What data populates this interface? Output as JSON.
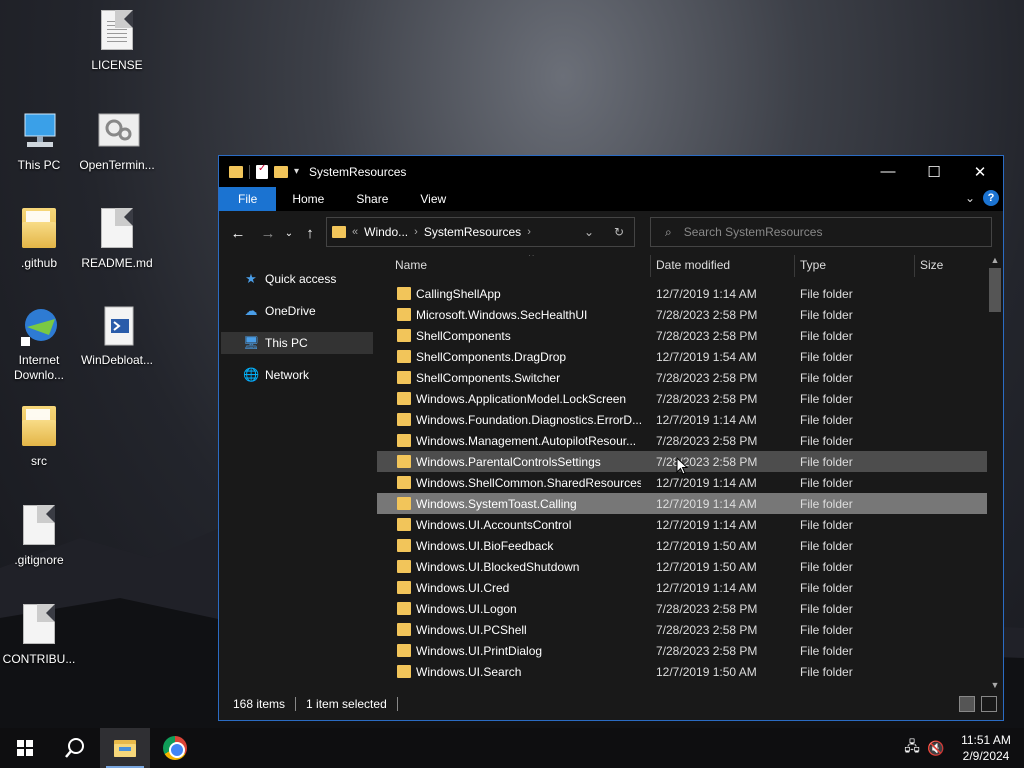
{
  "desktop": {
    "icons": [
      {
        "label": "LICENSE",
        "type": "document"
      },
      {
        "label": "This PC",
        "type": "computer"
      },
      {
        "label": "OpenTermin...",
        "type": "settings"
      },
      {
        "label": ".github",
        "type": "folder"
      },
      {
        "label": "README.md",
        "type": "document"
      },
      {
        "label": "Internet Downlo...",
        "type": "app"
      },
      {
        "label": "WinDebloat...",
        "type": "script"
      },
      {
        "label": "src",
        "type": "folder"
      },
      {
        "label": ".gitignore",
        "type": "document"
      },
      {
        "label": "CONTRIBU...",
        "type": "document"
      }
    ]
  },
  "explorer": {
    "title": "SystemResources",
    "window_buttons": {
      "minimize": "—",
      "maximize": "☐",
      "close": "✕"
    },
    "ribbon_tabs": [
      "File",
      "Home",
      "Share",
      "View"
    ],
    "help_label": "?",
    "nav_icons": {
      "back": "←",
      "forward": "→",
      "recent": "⌄",
      "up": "↑"
    },
    "address": {
      "overflow": "«",
      "segments": [
        "Windo...",
        "SystemResources"
      ],
      "separator": "›",
      "refresh_icon": "↻",
      "dropdown_icon": "⌄"
    },
    "search": {
      "placeholder": "Search SystemResources",
      "icon": "⌕"
    },
    "nav_pane": [
      {
        "label": "Quick access",
        "icon": "star-icon",
        "glyph": "★"
      },
      {
        "label": "OneDrive",
        "icon": "cloud-icon",
        "glyph": "☁"
      },
      {
        "label": "This PC",
        "icon": "computer-icon",
        "glyph": "🖥",
        "selected": true
      },
      {
        "label": "Network",
        "icon": "network-icon",
        "glyph": "🌐"
      }
    ],
    "columns": [
      "Name",
      "Date modified",
      "Type",
      "Size"
    ],
    "files": [
      {
        "name": "CallingShellApp",
        "date": "12/7/2019 1:14 AM",
        "type": "File folder"
      },
      {
        "name": "Microsoft.Windows.SecHealthUI",
        "date": "7/28/2023 2:58 PM",
        "type": "File folder"
      },
      {
        "name": "ShellComponents",
        "date": "7/28/2023 2:58 PM",
        "type": "File folder"
      },
      {
        "name": "ShellComponents.DragDrop",
        "date": "12/7/2019 1:54 AM",
        "type": "File folder"
      },
      {
        "name": "ShellComponents.Switcher",
        "date": "7/28/2023 2:58 PM",
        "type": "File folder"
      },
      {
        "name": "Windows.ApplicationModel.LockScreen",
        "date": "7/28/2023 2:58 PM",
        "type": "File folder"
      },
      {
        "name": "Windows.Foundation.Diagnostics.ErrorD...",
        "date": "12/7/2019 1:14 AM",
        "type": "File folder"
      },
      {
        "name": "Windows.Management.AutopilotResour...",
        "date": "7/28/2023 2:58 PM",
        "type": "File folder"
      },
      {
        "name": "Windows.ParentalControlsSettings",
        "date": "7/28/2023 2:58 PM",
        "type": "File folder",
        "state": "hover"
      },
      {
        "name": "Windows.ShellCommon.SharedResources",
        "date": "12/7/2019 1:14 AM",
        "type": "File folder"
      },
      {
        "name": "Windows.SystemToast.Calling",
        "date": "12/7/2019 1:14 AM",
        "type": "File folder",
        "state": "selected"
      },
      {
        "name": "Windows.UI.AccountsControl",
        "date": "12/7/2019 1:14 AM",
        "type": "File folder"
      },
      {
        "name": "Windows.UI.BioFeedback",
        "date": "12/7/2019 1:50 AM",
        "type": "File folder"
      },
      {
        "name": "Windows.UI.BlockedShutdown",
        "date": "12/7/2019 1:50 AM",
        "type": "File folder"
      },
      {
        "name": "Windows.UI.Cred",
        "date": "12/7/2019 1:14 AM",
        "type": "File folder"
      },
      {
        "name": "Windows.UI.Logon",
        "date": "7/28/2023 2:58 PM",
        "type": "File folder"
      },
      {
        "name": "Windows.UI.PCShell",
        "date": "7/28/2023 2:58 PM",
        "type": "File folder"
      },
      {
        "name": "Windows.UI.PrintDialog",
        "date": "7/28/2023 2:58 PM",
        "type": "File folder"
      },
      {
        "name": "Windows.UI.Search",
        "date": "12/7/2019 1:50 AM",
        "type": "File folder"
      }
    ],
    "status": {
      "items": "168 items",
      "selected": "1 item selected"
    }
  },
  "taskbar": {
    "clock_time": "11:51 AM",
    "clock_date": "2/9/2024",
    "pinned": [
      "start",
      "search",
      "file-explorer",
      "chrome"
    ]
  },
  "colors": {
    "accent": "#1b73d1",
    "selected_row": "#777777",
    "hover_row": "#4d4d4d",
    "folder": "#f2c55a"
  }
}
